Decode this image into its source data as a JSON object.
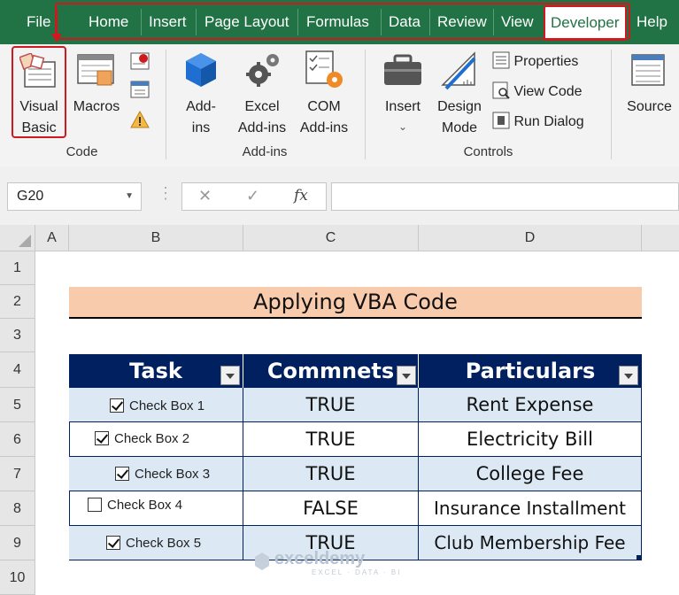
{
  "menu": {
    "tabs": [
      "File",
      "Home",
      "Insert",
      "Page Layout",
      "Formulas",
      "Data",
      "Review",
      "View",
      "Developer",
      "Help"
    ],
    "active_tab": "Developer"
  },
  "ribbon": {
    "code": {
      "visual_basic": [
        "Visual",
        "Basic"
      ],
      "macros": "Macros",
      "label": "Code"
    },
    "addins": {
      "addins": [
        "Add-",
        "ins"
      ],
      "excel_addins": [
        "Excel",
        "Add-ins"
      ],
      "com_addins": [
        "COM",
        "Add-ins"
      ],
      "label": "Add-ins"
    },
    "controls": {
      "insert": "Insert",
      "design_mode": [
        "Design",
        "Mode"
      ],
      "properties": "Properties",
      "view_code": "View Code",
      "run_dialog": "Run Dialog",
      "label": "Controls"
    },
    "xml": {
      "source": "Source"
    }
  },
  "formula_bar": {
    "name_box": "G20",
    "cancel": "✕",
    "enter": "✓",
    "fx": "fx",
    "formula": ""
  },
  "sheet": {
    "columns": [
      "A",
      "B",
      "C",
      "D"
    ],
    "rows": [
      "1",
      "2",
      "3",
      "4",
      "5",
      "6",
      "7",
      "8",
      "9",
      "10"
    ],
    "banner": "Applying VBA Code",
    "headers": [
      "Task",
      "Commnets",
      "Particulars"
    ],
    "data": [
      {
        "task": "Check Box 1",
        "checked": true,
        "comment": "TRUE",
        "particular": "Rent Expense"
      },
      {
        "task": "Check Box 2",
        "checked": true,
        "comment": "TRUE",
        "particular": "Electricity Bill"
      },
      {
        "task": "Check Box 3",
        "checked": true,
        "comment": "TRUE",
        "particular": "College Fee"
      },
      {
        "task": "Check Box 4",
        "checked": false,
        "comment": "FALSE",
        "particular": "Insurance Installment"
      },
      {
        "task": "Check Box 5",
        "checked": true,
        "comment": "TRUE",
        "particular": "Club Membership Fee"
      }
    ]
  },
  "watermark": {
    "name": "exceldemy",
    "tagline": "EXCEL · DATA · BI"
  },
  "colors": {
    "excel_green": "#217346",
    "header_navy": "#002060",
    "banner_peach": "#f8cbad",
    "row_blue": "#dce9f5",
    "highlight_red": "#d0191f"
  }
}
